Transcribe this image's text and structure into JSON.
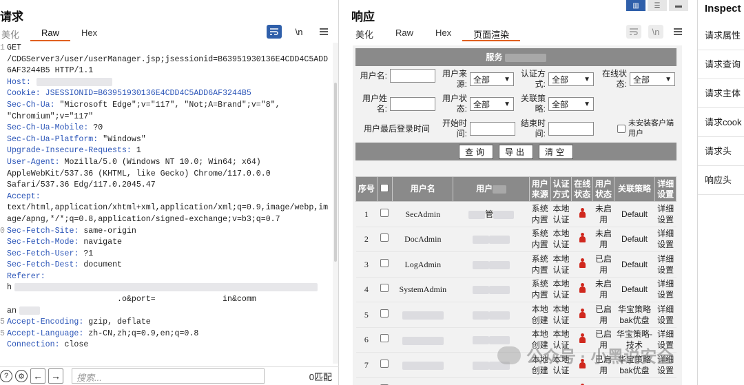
{
  "request": {
    "title": "请求",
    "tabs": [
      "美化",
      "Raw",
      "Hex"
    ],
    "active_tab": "Raw",
    "tool_icons": [
      "wrap-icon",
      "newline-icon",
      "menu-icon"
    ],
    "newline_label": "\\n",
    "lines": [
      {
        "g": "1",
        "name": "",
        "value": "GET"
      },
      {
        "g": "",
        "name": "",
        "value": "/CDGServer3/user/userManager.jsp;jsessionid=B63951930136E4CDD4C5ADD"
      },
      {
        "g": "",
        "name": "",
        "value": "6AF3244B5 HTTP/1.1"
      },
      {
        "g": "",
        "name": "Host:",
        "value": ""
      },
      {
        "g": "",
        "name": "Cookie: JSESSIONID=B63951930136E4CDD4C5ADD6AF3244B5",
        "value": ""
      },
      {
        "g": "",
        "name": "Sec-Ch-Ua:",
        "value": " \"Microsoft Edge\";v=\"117\", \"Not;A=Brand\";v=\"8\","
      },
      {
        "g": "",
        "name": "",
        "value": "\"Chromium\";v=\"117\""
      },
      {
        "g": "",
        "name": "Sec-Ch-Ua-Mobile:",
        "value": " ?0"
      },
      {
        "g": "",
        "name": "Sec-Ch-Ua-Platform:",
        "value": " \"Windows\""
      },
      {
        "g": "",
        "name": "Upgrade-Insecure-Requests:",
        "value": " 1"
      },
      {
        "g": "",
        "name": "User-Agent:",
        "value": " Mozilla/5.0 (Windows NT 10.0; Win64; x64)"
      },
      {
        "g": "",
        "name": "",
        "value": "AppleWebKit/537.36 (KHTML, like Gecko) Chrome/117.0.0.0"
      },
      {
        "g": "",
        "name": "",
        "value": "Safari/537.36 Edg/117.0.2045.47"
      },
      {
        "g": "",
        "name": "Accept:",
        "value": ""
      },
      {
        "g": "",
        "name": "",
        "value": "text/html,application/xhtml+xml,application/xml;q=0.9,image/webp,im"
      },
      {
        "g": "",
        "name": "",
        "value": "age/apng,*/*;q=0.8,application/signed-exchange;v=b3;q=0.7"
      },
      {
        "g": "0",
        "name": "Sec-Fetch-Site:",
        "value": " same-origin"
      },
      {
        "g": "",
        "name": "Sec-Fetch-Mode:",
        "value": " navigate"
      },
      {
        "g": "",
        "name": "Sec-Fetch-User:",
        "value": " ?1"
      },
      {
        "g": "",
        "name": "Sec-Fetch-Dest:",
        "value": " document"
      },
      {
        "g": "",
        "name": "Referer:",
        "value": ""
      },
      {
        "g": "",
        "name": "",
        "value": "h"
      },
      {
        "g": "",
        "name": "",
        "value": "                       .o&port=              in&comm"
      },
      {
        "g": "",
        "name": "",
        "value": "an"
      },
      {
        "g": "5",
        "name": "Accept-Encoding:",
        "value": " gzip, deflate"
      },
      {
        "g": "5",
        "name": "Accept-Language:",
        "value": " zh-CN,zh;q=0.9,en;q=0.8"
      },
      {
        "g": "",
        "name": "Connection:",
        "value": " close"
      }
    ],
    "search_placeholder": "搜索...",
    "match_count": "0匹配"
  },
  "response": {
    "title": "响应",
    "tabs": [
      "美化",
      "Raw",
      "Hex",
      "页面渲染"
    ],
    "active_tab": "页面渲染",
    "layout_icons": [
      "split-horizontal-icon",
      "split-vertical-icon",
      "single-pane-icon"
    ],
    "newline_label": "\\n",
    "page": {
      "header": "服务",
      "filters": {
        "username_label": "用户名:",
        "source_label": "用户来源:",
        "source_value": "全部",
        "auth_label": "认证方式:",
        "auth_value": "全部",
        "online_label": "在线状态:",
        "online_value": "全部",
        "realname_label": "用户姓名:",
        "status_label": "用户状态:",
        "status_value": "全部",
        "policy_label": "关联策略:",
        "policy_value": "全部",
        "lastlogin_label": "用户最后登录时间",
        "start_label": "开始时间:",
        "end_label": "结束时间:",
        "noclient_label": "未安装客户端用户"
      },
      "buttons": {
        "query": "查询",
        "export": "导出",
        "clear": "清空"
      },
      "columns": [
        "序号",
        "",
        "用户名",
        "用户",
        "用户来源",
        "认证方式",
        "在线状态",
        "用户状态",
        "关联策略",
        "详细设置"
      ],
      "rows": [
        {
          "no": "1",
          "user": "SecAdmin",
          "name": "管",
          "source": "系统内置",
          "auth": "本地认证",
          "state": "未启用",
          "state_color": "grey",
          "policy": "Default",
          "policy_color": "dark",
          "detail": "详细设置",
          "detail_color": "dark"
        },
        {
          "no": "2",
          "user": "DocAdmin",
          "name": "",
          "source": "系统内置",
          "auth": "本地认证",
          "state": "未启用",
          "state_color": "grey",
          "policy": "Default",
          "policy_color": "dark",
          "detail": "详细设置",
          "detail_color": "dark"
        },
        {
          "no": "3",
          "user": "LogAdmin",
          "name": "",
          "source": "系统内置",
          "auth": "本地认证",
          "state": "已启用",
          "state_color": "green",
          "policy": "Default",
          "policy_color": "dark",
          "detail": "详细设置",
          "detail_color": "dark"
        },
        {
          "no": "4",
          "user": "SystemAdmin",
          "name": "",
          "source": "系统内置",
          "auth": "本地认证",
          "state": "未启用",
          "state_color": "grey",
          "policy": "Default",
          "policy_color": "dark",
          "detail": "详细设置",
          "detail_color": "dark"
        },
        {
          "no": "5",
          "user": "",
          "name": "",
          "source": "本地创建",
          "auth": "本地认证",
          "state": "已启用",
          "state_color": "green",
          "policy": "华宝策略bak优盘",
          "policy_color": "maroon",
          "detail": "详细设置",
          "detail_color": "maroon"
        },
        {
          "no": "6",
          "user": "",
          "name": "",
          "source": "本地创建",
          "auth": "本地认证",
          "state": "已启用",
          "state_color": "green",
          "policy": "华宝策略-技术",
          "policy_color": "maroon",
          "detail": "详细设置",
          "detail_color": "maroon"
        },
        {
          "no": "7",
          "user": "",
          "name": "",
          "source": "本地创建",
          "auth": "本地认证",
          "state": "已启用",
          "state_color": "green",
          "policy": "华宝策略bak优盘",
          "policy_color": "maroon",
          "detail": "详细设置",
          "detail_color": "maroon"
        },
        {
          "no": "",
          "user": "",
          "name": "",
          "source": "本地",
          "auth": "本地",
          "state": "已启",
          "state_color": "green",
          "policy": "",
          "policy_color": "dark",
          "detail": "",
          "detail_color": "dark"
        }
      ]
    }
  },
  "inspector": {
    "title": "Inspect",
    "items": [
      "请求属性",
      "请求查询",
      "请求主体",
      "请求cook",
      "请求头",
      "响应头"
    ]
  },
  "watermark": "公众号 · 小黑说安全"
}
